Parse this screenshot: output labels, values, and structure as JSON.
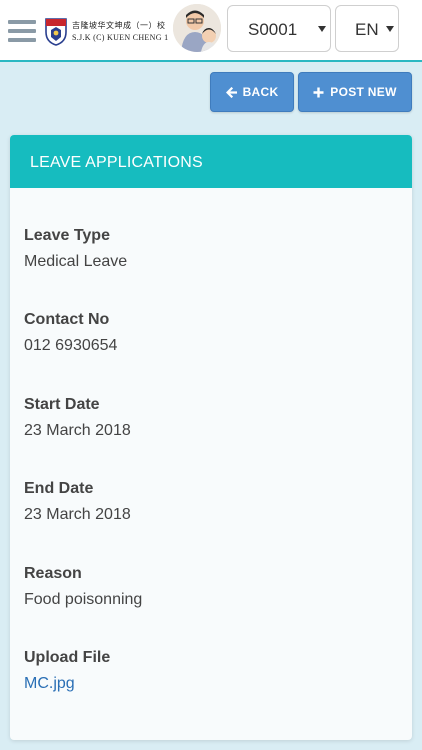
{
  "header": {
    "school_name_cn": "吉隆坡华文坤成（一）校",
    "school_name_en": "S.J.K (C) KUEN CHENG 1",
    "student_select": "S0001",
    "language_select": "EN"
  },
  "actions": {
    "back_label": "BACK",
    "post_new_label": "POST NEW"
  },
  "card": {
    "title": "LEAVE APPLICATIONS",
    "fields": [
      {
        "label": "Leave Type",
        "value": "Medical Leave"
      },
      {
        "label": "Contact No",
        "value": "012 6930654"
      },
      {
        "label": "Start Date",
        "value": "23 March 2018"
      },
      {
        "label": "End Date",
        "value": "23 March 2018"
      },
      {
        "label": "Reason",
        "value": "Food poisonning"
      },
      {
        "label": "Upload File",
        "value": "MC.jpg"
      }
    ]
  },
  "colors": {
    "accent": "#16bcbf",
    "button": "#4f8fd1",
    "background": "#d9edf4"
  },
  "icons": [
    "menu-icon",
    "school-crest-icon",
    "chevron-down-icon",
    "arrow-left-icon",
    "plus-icon"
  ]
}
